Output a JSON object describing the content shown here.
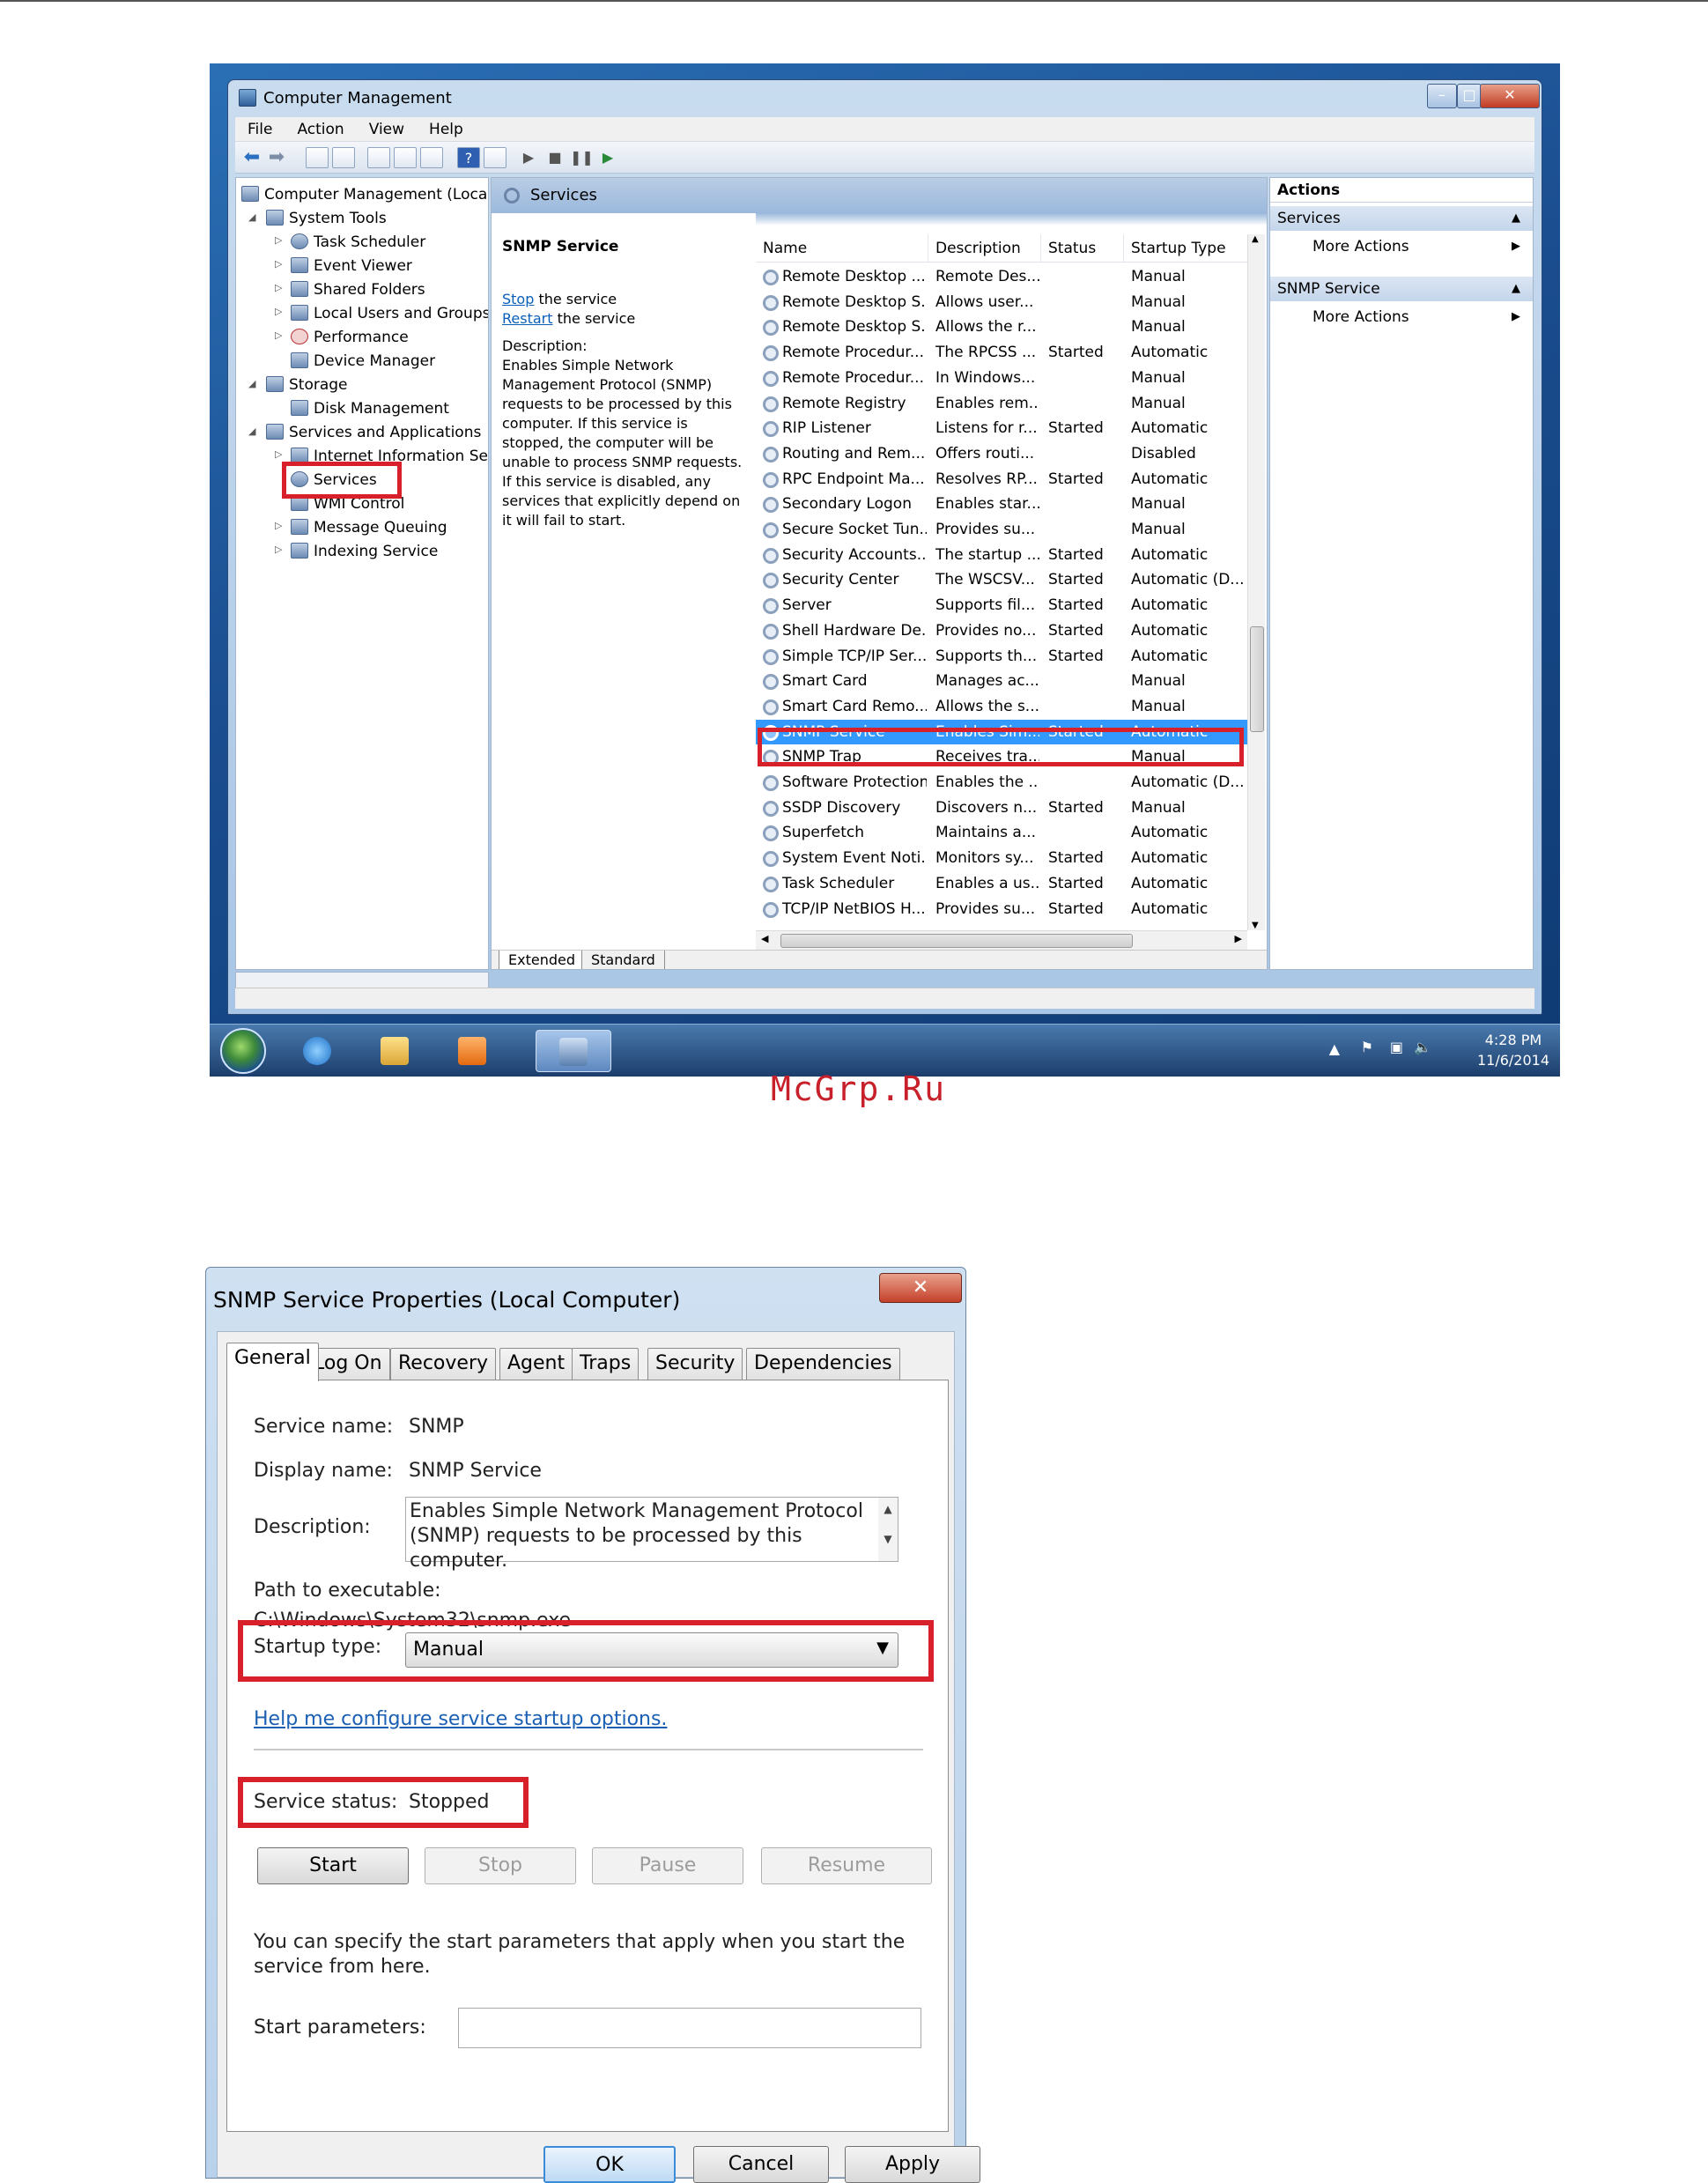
{
  "computer_management": {
    "window_title": "Computer Management",
    "menu": [
      "File",
      "Action",
      "View",
      "Help"
    ],
    "tree": [
      {
        "label": "Computer Management (Local",
        "level": 0
      },
      {
        "label": "System Tools",
        "level": 1
      },
      {
        "label": "Task Scheduler",
        "level": 2
      },
      {
        "label": "Event Viewer",
        "level": 2
      },
      {
        "label": "Shared Folders",
        "level": 2
      },
      {
        "label": "Local Users and Groups",
        "level": 2
      },
      {
        "label": "Performance",
        "level": 2
      },
      {
        "label": "Device Manager",
        "level": 2
      },
      {
        "label": "Storage",
        "level": 1
      },
      {
        "label": "Disk Management",
        "level": 2
      },
      {
        "label": "Services and Applications",
        "level": 1
      },
      {
        "label": "Internet Information Ser",
        "level": 2
      },
      {
        "label": "Services",
        "level": 2
      },
      {
        "label": "WMI Control",
        "level": 2
      },
      {
        "label": "Message Queuing",
        "level": 2
      },
      {
        "label": "Indexing Service",
        "level": 2
      }
    ],
    "pane_header": "Services",
    "selected_service": {
      "name": "SNMP Service",
      "stop_link": "Stop",
      "stop_suffix": " the service",
      "restart_link": "Restart",
      "restart_suffix": " the service",
      "description_label": "Description:",
      "description": "Enables Simple Network Management Protocol (SNMP) requests to be processed by this computer. If this service is stopped, the computer will be unable to process SNMP requests. If this service is disabled, any services that explicitly depend on it will fail to start."
    },
    "columns": [
      "Name",
      "Description",
      "Status",
      "Startup Type"
    ],
    "rows": [
      [
        "Remote Desktop ...",
        "Remote Des...",
        "",
        "Manual"
      ],
      [
        "Remote Desktop S...",
        "Allows user...",
        "",
        "Manual"
      ],
      [
        "Remote Desktop S...",
        "Allows the r...",
        "",
        "Manual"
      ],
      [
        "Remote Procedur...",
        "The RPCSS ...",
        "Started",
        "Automatic"
      ],
      [
        "Remote Procedur...",
        "In Windows...",
        "",
        "Manual"
      ],
      [
        "Remote Registry",
        "Enables rem...",
        "",
        "Manual"
      ],
      [
        "RIP Listener",
        "Listens for r...",
        "Started",
        "Automatic"
      ],
      [
        "Routing and Rem...",
        "Offers routi...",
        "",
        "Disabled"
      ],
      [
        "RPC Endpoint Ma...",
        "Resolves RP...",
        "Started",
        "Automatic"
      ],
      [
        "Secondary Logon",
        "Enables star...",
        "",
        "Manual"
      ],
      [
        "Secure Socket Tun...",
        "Provides su...",
        "",
        "Manual"
      ],
      [
        "Security Accounts...",
        "The startup ...",
        "Started",
        "Automatic"
      ],
      [
        "Security Center",
        "The WSCSV...",
        "Started",
        "Automatic (D..."
      ],
      [
        "Server",
        "Supports fil...",
        "Started",
        "Automatic"
      ],
      [
        "Shell Hardware De...",
        "Provides no...",
        "Started",
        "Automatic"
      ],
      [
        "Simple TCP/IP Ser...",
        "Supports th...",
        "Started",
        "Automatic"
      ],
      [
        "Smart Card",
        "Manages ac...",
        "",
        "Manual"
      ],
      [
        "Smart Card Remo...",
        "Allows the s...",
        "",
        "Manual"
      ],
      [
        "SNMP Service",
        "Enables Sim...",
        "Started",
        "Automatic"
      ],
      [
        "SNMP Trap",
        "Receives tra...",
        "",
        "Manual"
      ],
      [
        "Software Protection",
        "Enables the ...",
        "",
        "Automatic (D..."
      ],
      [
        "SSDP Discovery",
        "Discovers n...",
        "Started",
        "Manual"
      ],
      [
        "Superfetch",
        "Maintains a...",
        "",
        "Automatic"
      ],
      [
        "System Event Noti...",
        "Monitors sy...",
        "Started",
        "Automatic"
      ],
      [
        "Task Scheduler",
        "Enables a us...",
        "Started",
        "Automatic"
      ],
      [
        "TCP/IP NetBIOS H...",
        "Provides su...",
        "Started",
        "Automatic"
      ]
    ],
    "selected_row_index": 18,
    "bottom_tabs": [
      "Extended",
      "Standard"
    ],
    "actions": {
      "title": "Actions",
      "section1": "Services",
      "section2": "SNMP Service",
      "more_actions": "More Actions"
    },
    "taskbar": {
      "time": "4:28 PM",
      "date": "11/6/2014"
    }
  },
  "watermark": "McGrp.Ru",
  "dialog": {
    "title": "SNMP Service Properties (Local Computer)",
    "tabs": [
      "General",
      "Log On",
      "Recovery",
      "Agent",
      "Traps",
      "Security",
      "Dependencies"
    ],
    "service_name_label": "Service name:",
    "service_name": "SNMP",
    "display_name_label": "Display name:",
    "display_name": "SNMP Service",
    "description_label": "Description:",
    "description": "Enables Simple Network Management Protocol (SNMP) requests to be processed by this computer.",
    "path_label": "Path to executable:",
    "path": "C:\\Windows\\System32\\snmp.exe",
    "startup_type_label": "Startup type:",
    "startup_type": "Manual",
    "help_link": "Help me configure service startup options.",
    "service_status_label": "Service status:",
    "service_status": "Stopped",
    "buttons": {
      "start": "Start",
      "stop": "Stop",
      "pause": "Pause",
      "resume": "Resume"
    },
    "start_params_text": "You can specify the start parameters that apply when you start the service from here.",
    "start_params_label": "Start parameters:",
    "start_params_value": "",
    "ok": "OK",
    "cancel": "Cancel",
    "apply": "Apply",
    "colors": {
      "highlight_box": "#d8202a",
      "selection": "#3399ff",
      "link": "#1a5fb4"
    }
  }
}
